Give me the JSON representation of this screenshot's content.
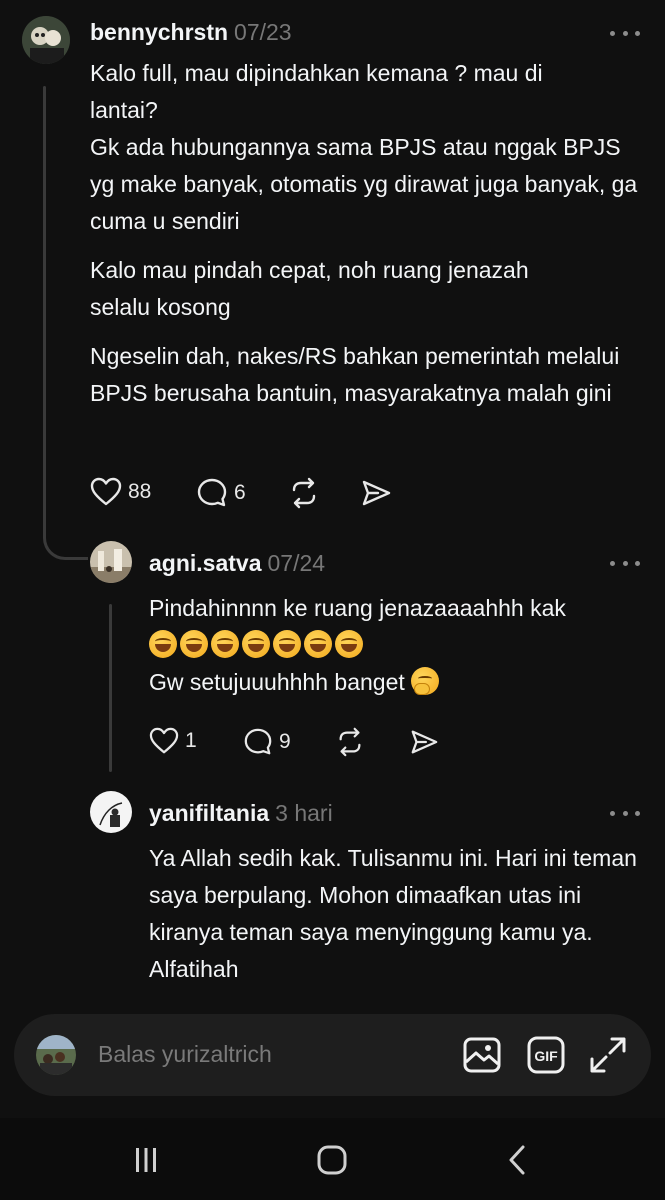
{
  "colors": {
    "background": "#101010",
    "text": "#f3f5f7",
    "muted": "#777777",
    "thread_line": "#3a3a3a",
    "reply_bar": "#1e1e1e"
  },
  "posts": [
    {
      "username": "bennychrstn",
      "time": "07/23",
      "paragraphs": [
        "Kalo full, mau dipindahkan kemana ? mau di lantai?",
        "Gk ada hubungannya sama BPJS atau nggak BPJS yg make banyak, otomatis yg dirawat juga banyak, ga cuma u sendiri",
        "Kalo mau pindah cepat, noh ruang jenazah selalu kosong",
        "Ngeselin dah, nakes/RS bahkan pemerintah melalui BPJS berusaha bantuin, masyarakatnya malah gini"
      ],
      "likes": "88",
      "replies": "6"
    },
    {
      "username": "agni.satva",
      "time": "07/24",
      "line1": "Pindahinnnn ke ruang jenazaaaahhh kak",
      "laugh_emoji_count": 7,
      "line3": "Gw setujuuuhhhh banget",
      "likes": "1",
      "replies": "9"
    },
    {
      "username": "yanifiltania",
      "time": "3 hari",
      "paragraphs": [
        "Ya Allah sedih kak. Tulisanmu ini. Hari ini teman saya berpulang. Mohon dimaafkan utas ini kiranya teman saya menyinggung kamu ya. Alfatihah"
      ]
    }
  ],
  "reply_bar": {
    "placeholder": "Balas yurizaltrich",
    "gif_label": "GIF"
  },
  "icons": [
    "heart-icon",
    "comment-icon",
    "repost-icon",
    "share-icon",
    "more-icon",
    "image-icon",
    "gif-icon",
    "expand-icon",
    "recents-icon",
    "home-icon",
    "back-icon"
  ]
}
